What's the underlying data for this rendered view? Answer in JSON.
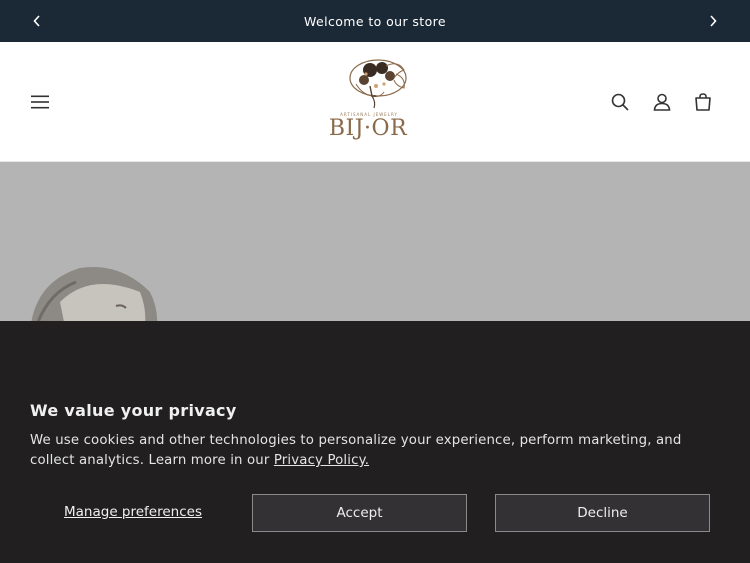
{
  "announcement": {
    "message": "Welcome to our store",
    "prev_icon": "chevron-left-icon",
    "next_icon": "chevron-right-icon"
  },
  "header": {
    "menu_icon": "hamburger-menu-icon",
    "logo": {
      "text": "BIJ·OR",
      "tagline": "ARTISANAL JEWELRY"
    },
    "icons": [
      "search-icon",
      "account-icon",
      "cart-icon"
    ]
  },
  "cookie_banner": {
    "title": "We value your privacy",
    "description": "We use cookies and other technologies to personalize your experience, perform marketing, and collect analytics. Learn more in our ",
    "policy_link": "Privacy Policy.",
    "manage_label": "Manage preferences",
    "accept_label": "Accept",
    "decline_label": "Decline"
  },
  "colors": {
    "announcement_bg": "#1b2836",
    "cookie_bg": "#211f20",
    "logo_gold": "#8a6a4a",
    "hero_bg": "#b4b4b4"
  }
}
